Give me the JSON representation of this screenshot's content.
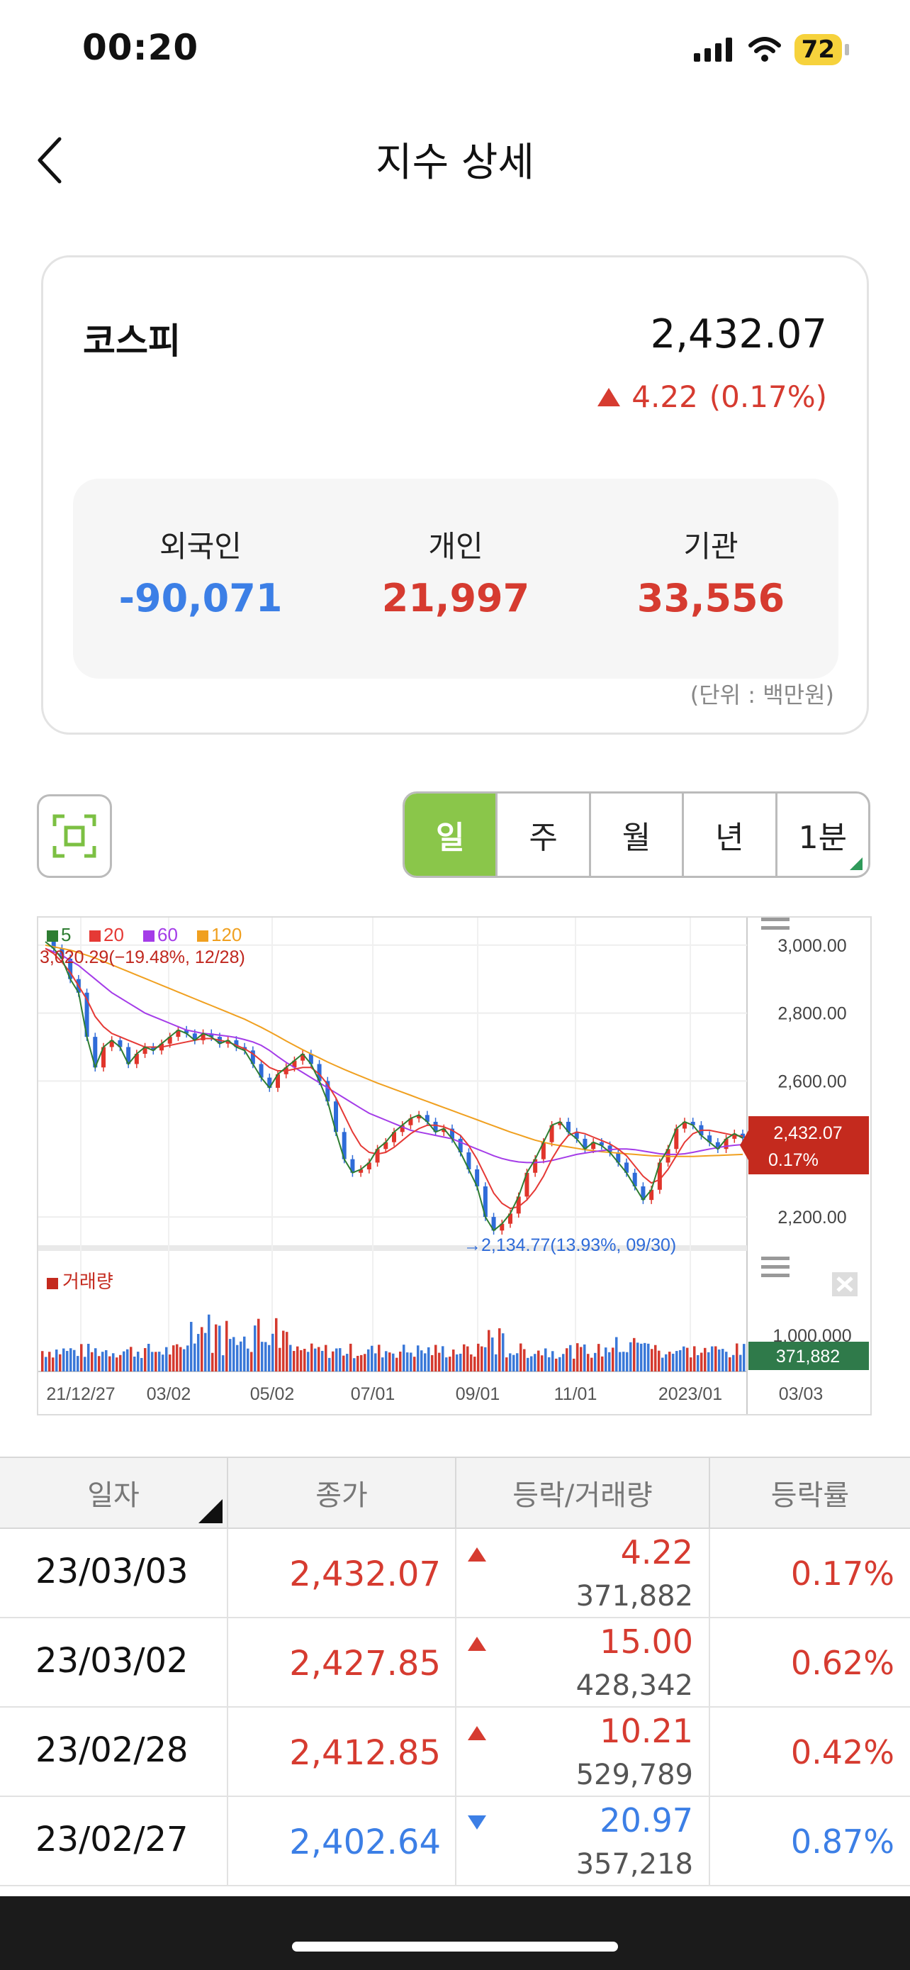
{
  "status": {
    "time": "00:20",
    "battery": "72"
  },
  "nav": {
    "title": "지수 상세"
  },
  "index": {
    "name": "코스피",
    "value": "2,432.07",
    "change": "4.22",
    "change_pct": "(0.17%)",
    "investors": [
      {
        "label": "외국인",
        "value": "-90,071",
        "color": "#3c7fe6"
      },
      {
        "label": "개인",
        "value": "21,997",
        "color": "#d63b30"
      },
      {
        "label": "기관",
        "value": "33,556",
        "color": "#d63b30"
      }
    ],
    "unit": "(단위 : 백만원)"
  },
  "period_tabs": [
    "일",
    "주",
    "월",
    "년",
    "1분"
  ],
  "active_period": "일",
  "chart_data": {
    "type": "line",
    "legend": [
      {
        "name": "5",
        "color": "#2e7d32"
      },
      {
        "name": "20",
        "color": "#e53935"
      },
      {
        "name": "60",
        "color": "#a43ce8"
      },
      {
        "name": "120",
        "color": "#f0a020"
      }
    ],
    "x_ticks": [
      "21/12/27",
      "03/02",
      "05/02",
      "07/01",
      "09/01",
      "11/01",
      "2023/01",
      "03/03"
    ],
    "y_ticks": [
      "3,000.00",
      "2,800.00",
      "2,600.00",
      "2,200.00"
    ],
    "ylim": [
      2100,
      3060
    ],
    "max_label": "3,020.29(−19.48%, 12/28)",
    "min_label": "2,134.77(13.93%, 09/30)",
    "current_value": "2,432.07",
    "current_pct": "0.17%",
    "volume_label": "거래량",
    "volume_tick": "1,000,000",
    "volume_current": "371,882",
    "close_series": [
      3010,
      2990,
      2960,
      2900,
      2860,
      2730,
      2640,
      2700,
      2720,
      2700,
      2650,
      2680,
      2700,
      2690,
      2710,
      2730,
      2750,
      2740,
      2720,
      2740,
      2730,
      2710,
      2720,
      2700,
      2690,
      2650,
      2610,
      2580,
      2620,
      2640,
      2660,
      2680,
      2650,
      2600,
      2540,
      2450,
      2370,
      2330,
      2340,
      2360,
      2400,
      2420,
      2450,
      2470,
      2490,
      2500,
      2480,
      2450,
      2460,
      2430,
      2390,
      2340,
      2290,
      2200,
      2160,
      2180,
      2210,
      2260,
      2330,
      2370,
      2420,
      2470,
      2480,
      2450,
      2430,
      2400,
      2420,
      2410,
      2390,
      2360,
      2330,
      2290,
      2250,
      2280,
      2360,
      2400,
      2460,
      2480,
      2470,
      2440,
      2420,
      2400,
      2430,
      2445,
      2432
    ],
    "ma20": [
      2990,
      2975,
      2950,
      2920,
      2880,
      2840,
      2790,
      2760,
      2740,
      2730,
      2720,
      2710,
      2700,
      2700,
      2700,
      2705,
      2710,
      2715,
      2720,
      2725,
      2725,
      2720,
      2715,
      2705,
      2695,
      2680,
      2660,
      2640,
      2630,
      2630,
      2635,
      2640,
      2640,
      2620,
      2590,
      2550,
      2500,
      2450,
      2410,
      2390,
      2385,
      2390,
      2405,
      2425,
      2445,
      2460,
      2470,
      2470,
      2465,
      2455,
      2440,
      2410,
      2370,
      2320,
      2270,
      2240,
      2225,
      2230,
      2250,
      2280,
      2320,
      2370,
      2410,
      2440,
      2450,
      2445,
      2435,
      2425,
      2415,
      2400,
      2380,
      2350,
      2320,
      2300,
      2310,
      2340,
      2380,
      2420,
      2445,
      2455,
      2455,
      2450,
      2445,
      2440,
      2438
    ],
    "ma60": [
      2990,
      2980,
      2970,
      2955,
      2940,
      2920,
      2900,
      2880,
      2860,
      2845,
      2830,
      2815,
      2800,
      2790,
      2780,
      2770,
      2760,
      2750,
      2745,
      2740,
      2738,
      2735,
      2732,
      2728,
      2722,
      2715,
      2705,
      2690,
      2672,
      2655,
      2640,
      2625,
      2610,
      2595,
      2580,
      2565,
      2550,
      2535,
      2520,
      2505,
      2495,
      2485,
      2475,
      2465,
      2455,
      2450,
      2445,
      2440,
      2435,
      2430,
      2420,
      2410,
      2400,
      2390,
      2380,
      2372,
      2366,
      2362,
      2360,
      2360,
      2362,
      2366,
      2372,
      2378,
      2384,
      2388,
      2392,
      2395,
      2398,
      2400,
      2400,
      2398,
      2394,
      2390,
      2386,
      2384,
      2384,
      2386,
      2390,
      2395,
      2400,
      2404,
      2408,
      2411,
      2413
    ],
    "ma120": [
      3000,
      2995,
      2990,
      2985,
      2978,
      2970,
      2962,
      2952,
      2942,
      2932,
      2922,
      2912,
      2902,
      2892,
      2882,
      2872,
      2862,
      2852,
      2842,
      2832,
      2822,
      2812,
      2802,
      2792,
      2782,
      2770,
      2758,
      2745,
      2732,
      2718,
      2705,
      2692,
      2680,
      2668,
      2656,
      2645,
      2634,
      2624,
      2614,
      2604,
      2594,
      2585,
      2576,
      2567,
      2558,
      2549,
      2540,
      2531,
      2522,
      2513,
      2504,
      2495,
      2486,
      2477,
      2468,
      2459,
      2450,
      2442,
      2434,
      2426,
      2420,
      2414,
      2410,
      2406,
      2402,
      2398,
      2395,
      2392,
      2390,
      2388,
      2386,
      2384,
      2382,
      2380,
      2379,
      2378,
      2378,
      2378,
      2378,
      2379,
      2380,
      2381,
      2382,
      2383,
      2384
    ]
  },
  "table": {
    "headers": [
      "일자",
      "종가",
      "등락/거래량",
      "등락률"
    ],
    "rows": [
      {
        "date": "23/03/03",
        "close": "2,432.07",
        "change": "4.22",
        "volume": "371,882",
        "rate": "0.17%",
        "dir": "up"
      },
      {
        "date": "23/03/02",
        "close": "2,427.85",
        "change": "15.00",
        "volume": "428,342",
        "rate": "0.62%",
        "dir": "up"
      },
      {
        "date": "23/02/28",
        "close": "2,412.85",
        "change": "10.21",
        "volume": "529,789",
        "rate": "0.42%",
        "dir": "up"
      },
      {
        "date": "23/02/27",
        "close": "2,402.64",
        "change": "20.97",
        "volume": "357,218",
        "rate": "0.87%",
        "dir": "down"
      }
    ]
  }
}
